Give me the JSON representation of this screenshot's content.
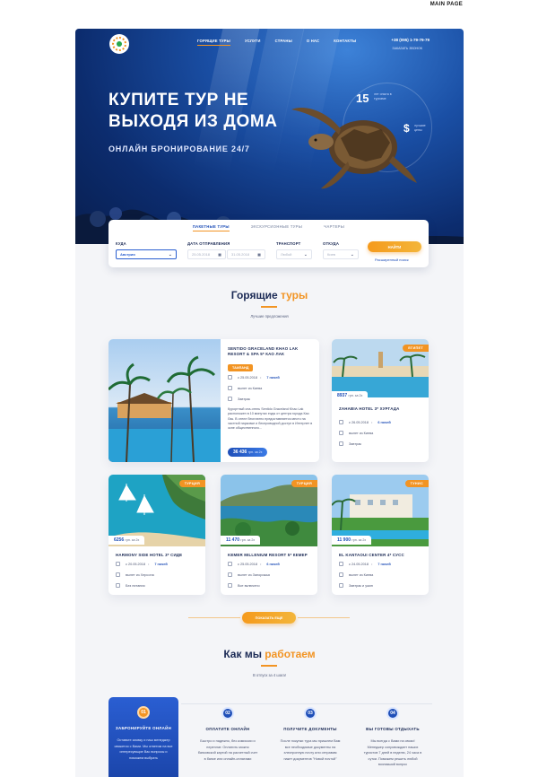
{
  "corner_label": "MAIN PAGE",
  "header": {
    "nav": [
      "ГОРЯЩИЕ ТУРЫ",
      "УСЛУГИ",
      "СТРАНЫ",
      "О НАС",
      "КОНТАКТЫ"
    ],
    "phone": "+38 (095) 1-79-79-79",
    "callback": "ЗАКАЗАТЬ ЗВОНОК"
  },
  "hero": {
    "title_line1": "КУПИТЕ ТУР НЕ",
    "title_line2": "ВЫХОДЯ ИЗ ДОМА",
    "subtitle": "ОНЛАЙН БРОНИРОВАНИЕ 24/7",
    "stat1_value": "15",
    "stat1_caption": "лет опыта в туризме",
    "stat2_value": "$",
    "stat2_caption": "лучшие цены"
  },
  "search": {
    "tabs": [
      "ПАКЕТНЫЕ ТУРЫ",
      "ЭКСКУРСИОННЫЕ ТУРЫ",
      "ЧАРТЕРЫ"
    ],
    "where_label": "КУДА",
    "where_value": "Австрия",
    "date_label": "ДАТА ОТПРАВЛЕНИЯ",
    "date_from": "25.05.2018",
    "date_to": "31.05.2018",
    "transport_label": "ТРАНСПОРТ",
    "transport_value": "Любой",
    "from_label": "ОТКУДА",
    "from_value": "Киев",
    "button": "НАЙТИ",
    "advanced": "Расширенный поиск"
  },
  "hot": {
    "title_main": "Горящие ",
    "title_accent": "туры",
    "subtitle": "Лучшие предложения"
  },
  "cards": {
    "big": {
      "name": "SENTIDO GRACELAND KHAO LAK RESORT & SPA 5* КАО ЛАК",
      "country": "ТАИЛАНД",
      "date": "с 25.05.2018",
      "nights": "7 ночей",
      "departure": "вылет из Киева",
      "meal": "Завтрак",
      "desc": "Курортный спа-отель Sentido Graceland Khao Lak расположен в 10 минутах езды от центра города Као Лак. В отеле бесплатно предоставляется место на частной парковке и беспроводной доступ в Интернет в зоне общественного...",
      "price": "36 436",
      "price_unit": "грн. за 2х"
    },
    "c2": {
      "badge": "ЕГИПЕТ",
      "price": "8937",
      "price_unit": "грн. за 2х",
      "name": "ZAHABIA HOTEL 3* ХУРГАДА",
      "date": "с 26.05.2018",
      "nights": "6 ночей",
      "departure": "вылет из Киева",
      "meal": "Завтрак"
    },
    "c3": {
      "badge": "ТУРЦИЯ",
      "price": "6256",
      "price_unit": "грн. за 2х",
      "name": "HARMONY SIDE HOTEL 3* СИДЕ",
      "date": "с 20.05.2018",
      "nights": "7 ночей",
      "departure": "вылет из Херсона",
      "meal": "Без питания"
    },
    "c4": {
      "badge": "ТУРЦИЯ",
      "price": "11 470",
      "price_unit": "грн. за 2х",
      "name": "KEMER MILLENIUM RESORT 5* КЕМЕР",
      "date": "с 25.05.2018",
      "nights": "6 ночей",
      "departure": "вылет из Запорожья",
      "meal": "Все включено"
    },
    "c5": {
      "badge": "ТУНИС",
      "price": "11 900",
      "price_unit": "грн. за 2х",
      "name": "EL KANTAOUI CENTER 4* СУСС",
      "date": "с 24.05.2018",
      "nights": "7 ночей",
      "departure": "вылет из Киева",
      "meal": "Завтрак и ужин"
    }
  },
  "show_more": "ПОКАЗАТЬ ЕЩЕ",
  "how": {
    "title_main": "Как мы ",
    "title_accent": "работаем",
    "subtitle": "В отпуск за 4 шага!",
    "steps": [
      {
        "num": "01",
        "title": "ЗАБРОНИРУЙТЕ ОНЛАЙН",
        "text": "Оставьте заявку и наш менеджер свяжется с Вами. Мы ответим на все интересующие Вас вопросы и поможем выбрать"
      },
      {
        "num": "02",
        "title": "ОПЛАТИТЕ ОНЛАЙН",
        "text": "Быстро и надежно, без комиссии и переплат. Оплатить можно банковской картой на расчетный счет в банке или онлайн-оплатами"
      },
      {
        "num": "03",
        "title": "ПОЛУЧИТЕ ДОКУМЕНТЫ",
        "text": "После покупки тура мы пришлем Вам все необходимые документы на электронную почту или отправим пакет документов \"Новой почтой\""
      },
      {
        "num": "04",
        "title": "ВЫ ГОТОВЫ ОТДЫХАТЬ",
        "text": "Мы всегда с Вами на связи! Менеджер сопровождает наших туристов 7 дней в неделю, 24 часа в сутки. Поможем решить любой возникший вопрос"
      }
    ]
  }
}
